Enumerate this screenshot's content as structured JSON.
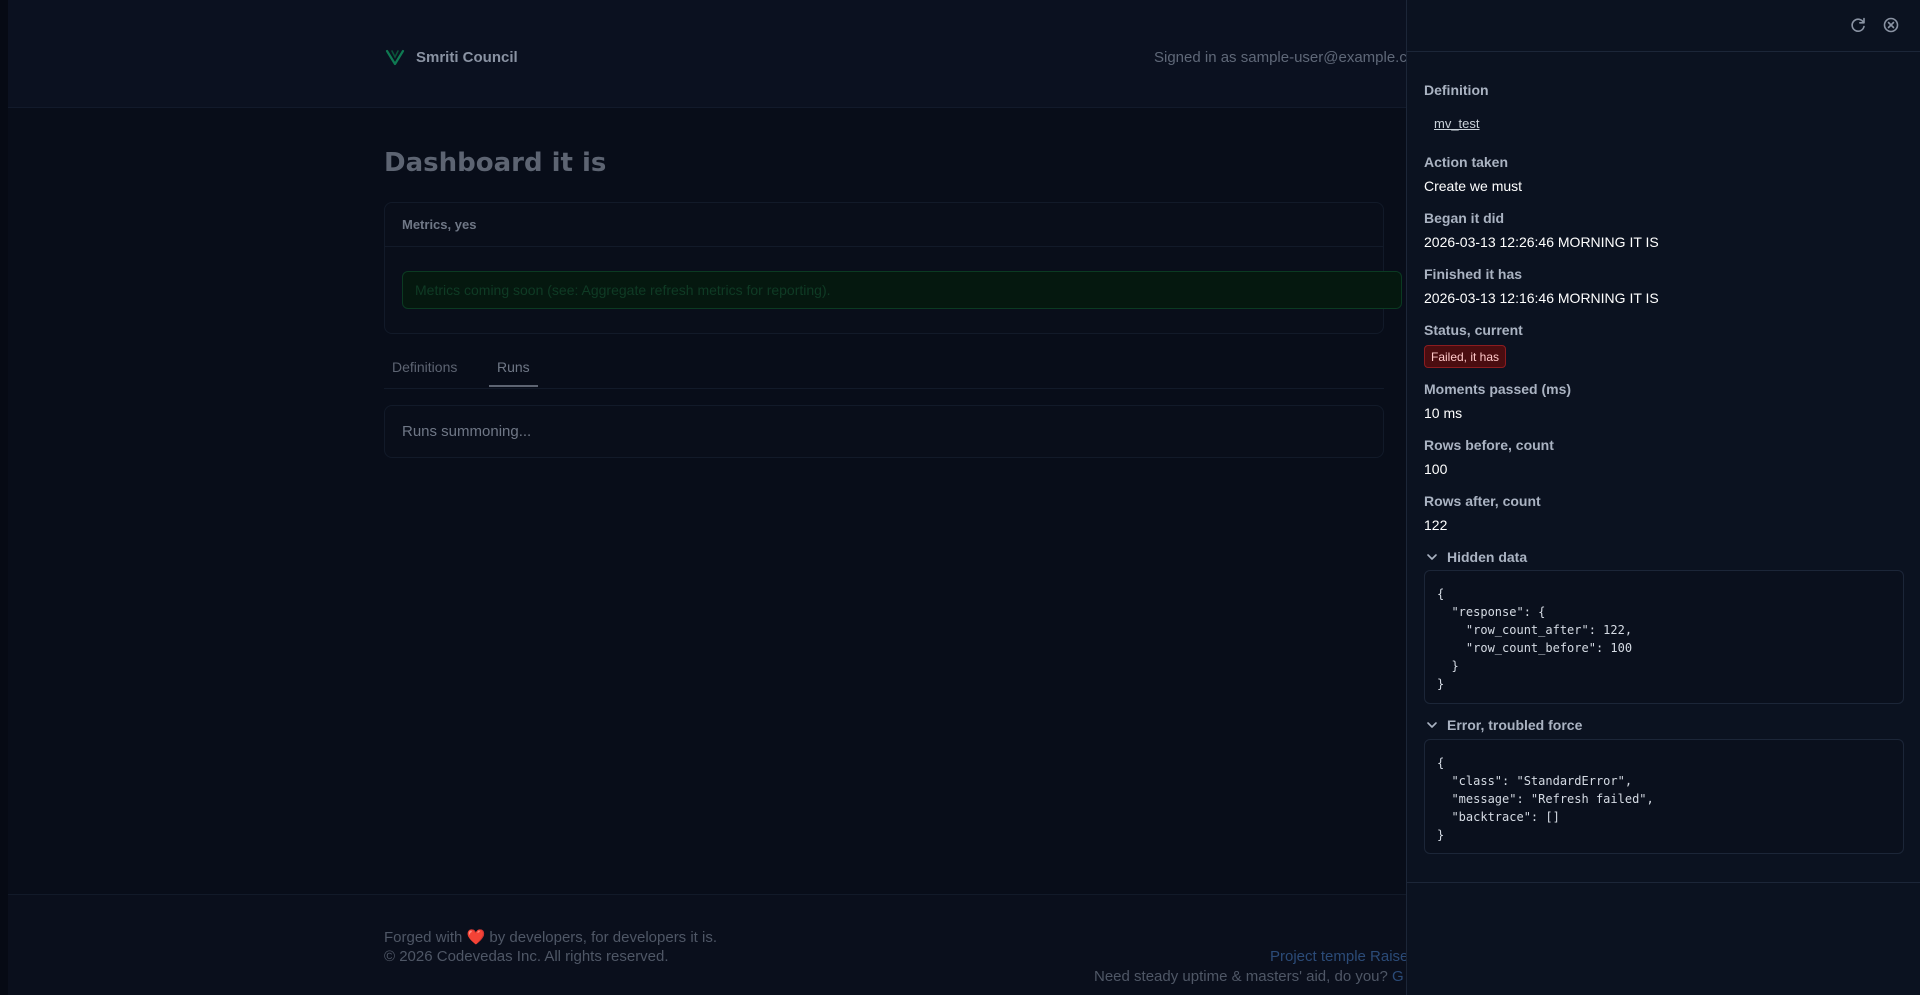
{
  "header": {
    "app_name": "Smriti Council",
    "signed_in": "Signed in as sample-user@example.c"
  },
  "main": {
    "title": "Dashboard it is",
    "metrics": {
      "title": "Metrics, yes",
      "note": "Metrics coming soon (see: Aggregate refresh metrics for reporting)."
    },
    "tabs": [
      {
        "label": "Definitions"
      },
      {
        "label": "Runs",
        "active": true
      }
    ],
    "runs_status": "Runs summoning..."
  },
  "footer": {
    "forged_prefix": "Forged with",
    "heart": "❤️",
    "forged_suffix": "by developers, for developers it is.",
    "copyright": "© 2026 Codevedas Inc. All rights reserved.",
    "project_link": "Project temple Raise",
    "uptime_text": "Need steady uptime & masters' aid, do you?",
    "uptime_link": "G"
  },
  "drawer": {
    "definition_label": "Definition",
    "definition_value": "mv_test",
    "action_label": "Action taken",
    "action_value": "Create we must",
    "began_label": "Began it did",
    "began_value": "2026-03-13 12:26:46 MORNING IT IS",
    "finished_label": "Finished it has",
    "finished_value": "2026-03-13 12:16:46 MORNING IT IS",
    "status_label": "Status, current",
    "status_value": "Failed, it has",
    "duration_label": "Moments passed (ms)",
    "duration_value": "10 ms",
    "rows_before_label": "Rows before, count",
    "rows_before_value": "100",
    "rows_after_label": "Rows after, count",
    "rows_after_value": "122",
    "hidden_data_label": "Hidden data",
    "hidden_data_json": "{\n  \"response\": {\n    \"row_count_after\": 122,\n    \"row_count_before\": 100\n  }\n}",
    "error_label": "Error, troubled force",
    "error_json": "{\n  \"class\": \"StandardError\",\n  \"message\": \"Refresh failed\",\n  \"backtrace\": []\n}"
  },
  "colors": {
    "accent_green": "#1fbf7a",
    "status_failed_bg": "#4a0d10",
    "status_failed_text": "#ffc9c9"
  },
  "icons": {
    "logo": "v-logo-icon",
    "refresh": "refresh-icon",
    "close": "close-circle-icon",
    "chevron": "chevron-down-icon"
  }
}
